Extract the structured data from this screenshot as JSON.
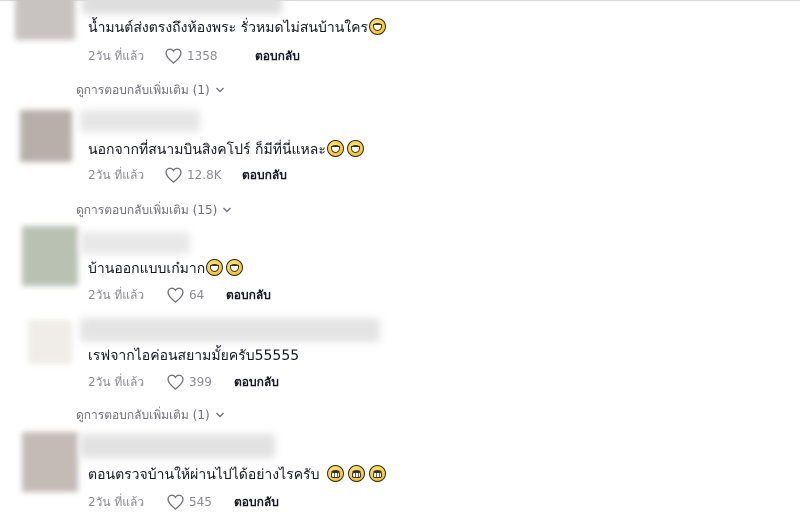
{
  "comments": [
    {
      "text": "น้ำมนต์ส่งตรงถึงห้องพระ รั่วหมดไม่สนบ้านใคร",
      "time": "2วัน ที่แล้ว",
      "likes": "1358",
      "reply": "ตอบกลับ",
      "emoji": [
        "rolling-on-floor-laughing-emoji"
      ]
    },
    {
      "text": "นอกจากที่สนามบินสิงคโปร์ ก็มีที่นี่แหละ",
      "time": "2วัน ที่แล้ว",
      "likes": "12.8K",
      "reply": "ตอบกลับ",
      "emoji": [
        "grinning-sweat-emoji",
        "grinning-sweat-emoji"
      ]
    },
    {
      "text": "บ้านออกแบบเก๋มาก",
      "time": "2วัน ที่แล้ว",
      "likes": "64",
      "reply": "ตอบกลับ",
      "emoji": [
        "tears-of-joy-emoji",
        "tears-of-joy-emoji"
      ]
    },
    {
      "text": "เรฟจากไอค่อนสยามมั้ยครับ55555",
      "time": "2วัน ที่แล้ว",
      "likes": "399",
      "reply": "ตอบกลับ",
      "emoji": []
    },
    {
      "text": "ตอนตรวจบ้านให้ผ่านไปได้อย่างไรครับ",
      "time": "2วัน ที่แล้ว",
      "likes": "545",
      "reply": "ตอบกลับ",
      "emoji": [
        "grinning-teeth-emoji",
        "grinning-teeth-emoji",
        "grinning-teeth-emoji"
      ]
    }
  ],
  "more_replies": [
    {
      "label": "ดูการตอบกลับเพิ่มเติม (1)"
    },
    {
      "label": "ดูการตอบกลับเพิ่มเติม (15)"
    },
    {
      "label": "ดูการตอบกลับเพิ่มเติม (1)"
    }
  ],
  "icons": {
    "like": "heart-outline-icon",
    "expand": "chevron-down-icon"
  },
  "colors": {
    "text": "#161823",
    "meta": "#8a8b91",
    "more_replies": "#6f7077",
    "background": "#ffffff",
    "emoji_fill": "#f7c531"
  }
}
